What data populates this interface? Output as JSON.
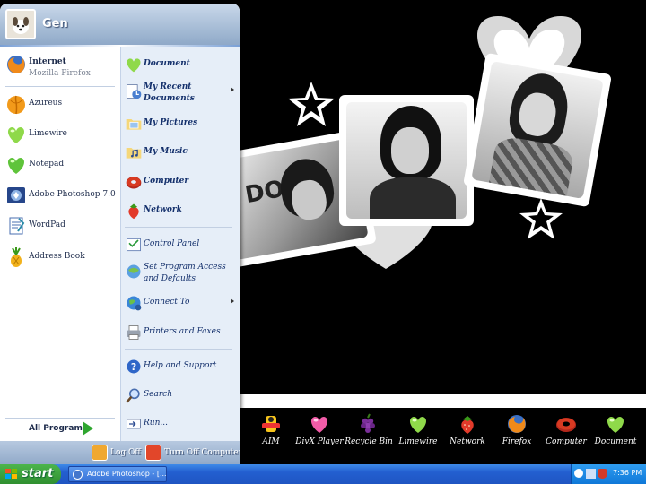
{
  "user": {
    "name": "Gen"
  },
  "start_menu": {
    "pinned": [
      {
        "label": "Internet",
        "sublabel": "Mozilla Firefox",
        "icon": "firefox-icon"
      }
    ],
    "recent": [
      {
        "label": "Azureus",
        "icon": "azureus-frog-icon"
      },
      {
        "label": "Limewire",
        "icon": "green-heart-icon"
      },
      {
        "label": "Notepad",
        "icon": "green-heart-icon"
      },
      {
        "label": "Adobe Photoshop 7.0",
        "icon": "photoshop-icon"
      },
      {
        "label": "WordPad",
        "icon": "wordpad-icon"
      },
      {
        "label": "Address Book",
        "icon": "pineapple-icon"
      }
    ],
    "all_programs_label": "All Programs",
    "right_items": [
      {
        "label": "Document",
        "icon": "green-heart-icon"
      },
      {
        "label": "My Recent",
        "label2": "Documents",
        "icon": "recent-documents-icon"
      },
      {
        "label": "My Pictures",
        "icon": "pictures-folder-icon"
      },
      {
        "label": "My Music",
        "icon": "music-folder-icon"
      },
      {
        "label": "Computer",
        "icon": "donut-icon"
      },
      {
        "label": "Network",
        "icon": "strawberry-icon"
      },
      {
        "label": "Control Panel",
        "icon": "control-panel-icon"
      },
      {
        "label": "Set Program Access",
        "label2": "and Defaults",
        "icon": "program-access-icon"
      },
      {
        "label": "Connect To",
        "icon": "connect-globe-icon"
      },
      {
        "label": "Printers and Faxes",
        "icon": "printer-icon"
      },
      {
        "label": "Help and Support",
        "icon": "help-icon"
      },
      {
        "label": "Search",
        "icon": "search-icon"
      },
      {
        "label": "Run...",
        "icon": "run-icon"
      }
    ],
    "footer": {
      "logoff_label": "Log Off",
      "turnoff_label": "Turn Off Computer"
    }
  },
  "dock": [
    {
      "label": "AIM",
      "icon": "aim-icon"
    },
    {
      "label": "DivX Player",
      "icon": "pink-heart-icon"
    },
    {
      "label": "Recycle Bin",
      "icon": "grapes-icon"
    },
    {
      "label": "Limewire",
      "icon": "green-heart-icon"
    },
    {
      "label": "Network",
      "icon": "strawberry-icon"
    },
    {
      "label": "Firefox",
      "icon": "firefox-icon"
    },
    {
      "label": "Computer",
      "icon": "donut-icon"
    },
    {
      "label": "Document",
      "icon": "green-heart-icon"
    }
  ],
  "taskbar": {
    "start_label": "start",
    "tasks": [
      {
        "label": "Adobe Photoshop - [..."
      }
    ],
    "clock": "7:36 PM"
  },
  "wallpaper": {
    "sign_text": "DOE"
  },
  "colors": {
    "menu_right_bg": "#e6eef8",
    "taskbar": "#235fd0",
    "start_green": "#2f8f2f"
  }
}
